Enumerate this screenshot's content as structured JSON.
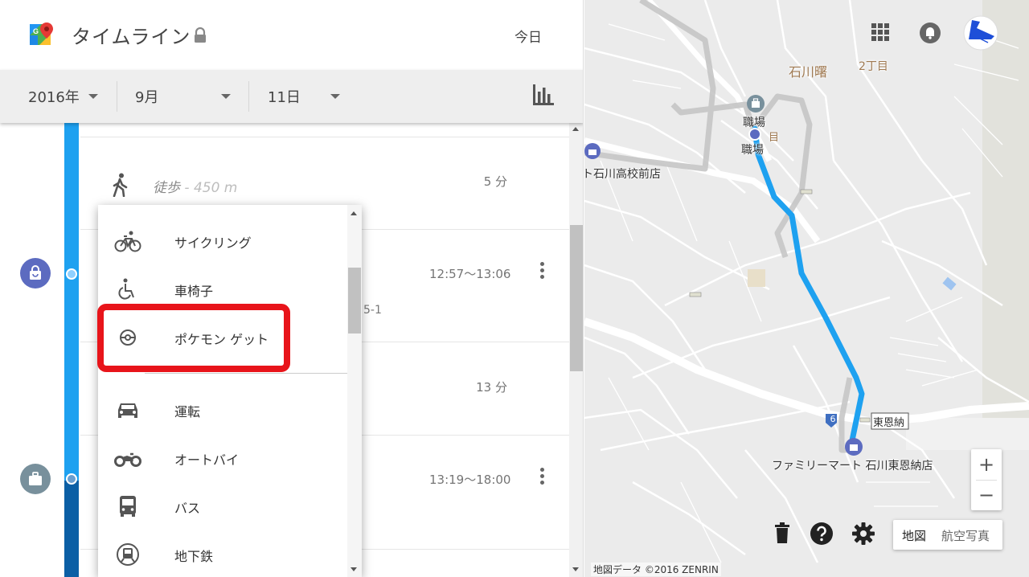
{
  "header": {
    "title": "タイムライン",
    "today_label": "今日"
  },
  "date_selector": {
    "year": "2016年",
    "month": "9月",
    "day": "11日"
  },
  "timeline": {
    "walk_segment": {
      "mode": "徒歩",
      "distance": " - 450 m",
      "duration": "5 分"
    },
    "place1": {
      "time_range": "12:57〜13:06",
      "partial_text": "5-1"
    },
    "segment2_duration": "13 分",
    "place2": {
      "time_range": "13:19〜18:00"
    }
  },
  "activity_menu": {
    "items": [
      {
        "label": "サイクリング",
        "icon": "bicycle-icon"
      },
      {
        "label": "車椅子",
        "icon": "wheelchair-icon"
      },
      {
        "label": "ポケモン ゲット",
        "icon": "pokeball-icon",
        "highlighted": true
      },
      {
        "label": "運転",
        "icon": "car-icon"
      },
      {
        "label": "オートバイ",
        "icon": "motorcycle-icon"
      },
      {
        "label": "バス",
        "icon": "bus-icon"
      },
      {
        "label": "地下鉄",
        "icon": "subway-icon"
      }
    ]
  },
  "map": {
    "labels": {
      "area_name": "石川曙",
      "chome": "2丁目",
      "workplace_1": "職場",
      "workplace_2": "職場",
      "chome_small": "目",
      "store_partial": "ト石川高校前店",
      "station": "東恩納",
      "route_number": "6",
      "store": "ファミリーマート 石川東恩納店"
    },
    "zoom_in": "+",
    "zoom_out": "−",
    "map_type": {
      "map": "地図",
      "satellite": "航空写真"
    },
    "attribution": "地図データ ©2016 ZENRIN",
    "route_color": "#1ea1f0"
  }
}
